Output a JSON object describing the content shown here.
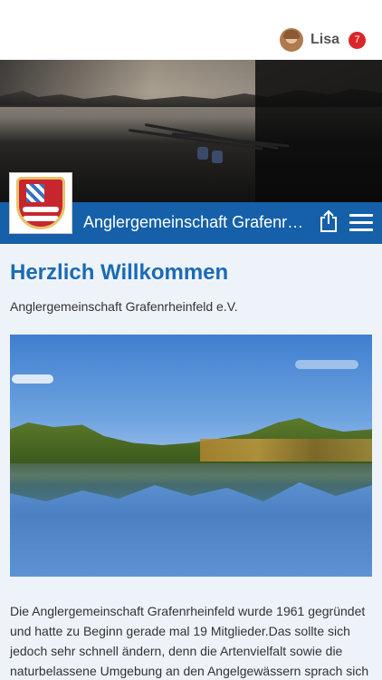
{
  "user": {
    "name": "Lisa",
    "notification_count": "7"
  },
  "header": {
    "site_title": "Anglergemeinschaft Grafenrheinfeld e.V.",
    "accent_color": "#1560a8"
  },
  "main": {
    "welcome_heading": "Herzlich Willkommen",
    "subtitle": "Anglergemeinschaft Grafenrheinfeld e.V.",
    "body_text": "Die Anglergemeinschaft Grafenrheinfeld wurde 1961 gegründet und hatte zu Beginn gerade mal 19 Mitglieder.Das sollte sich jedoch sehr schnell ändern, denn die Artenvielfalt sowie die naturbelassene Umgebung an den Angelgewässern sprach sich"
  },
  "icons": {
    "share": "share-icon",
    "menu": "hamburger-menu-icon"
  }
}
